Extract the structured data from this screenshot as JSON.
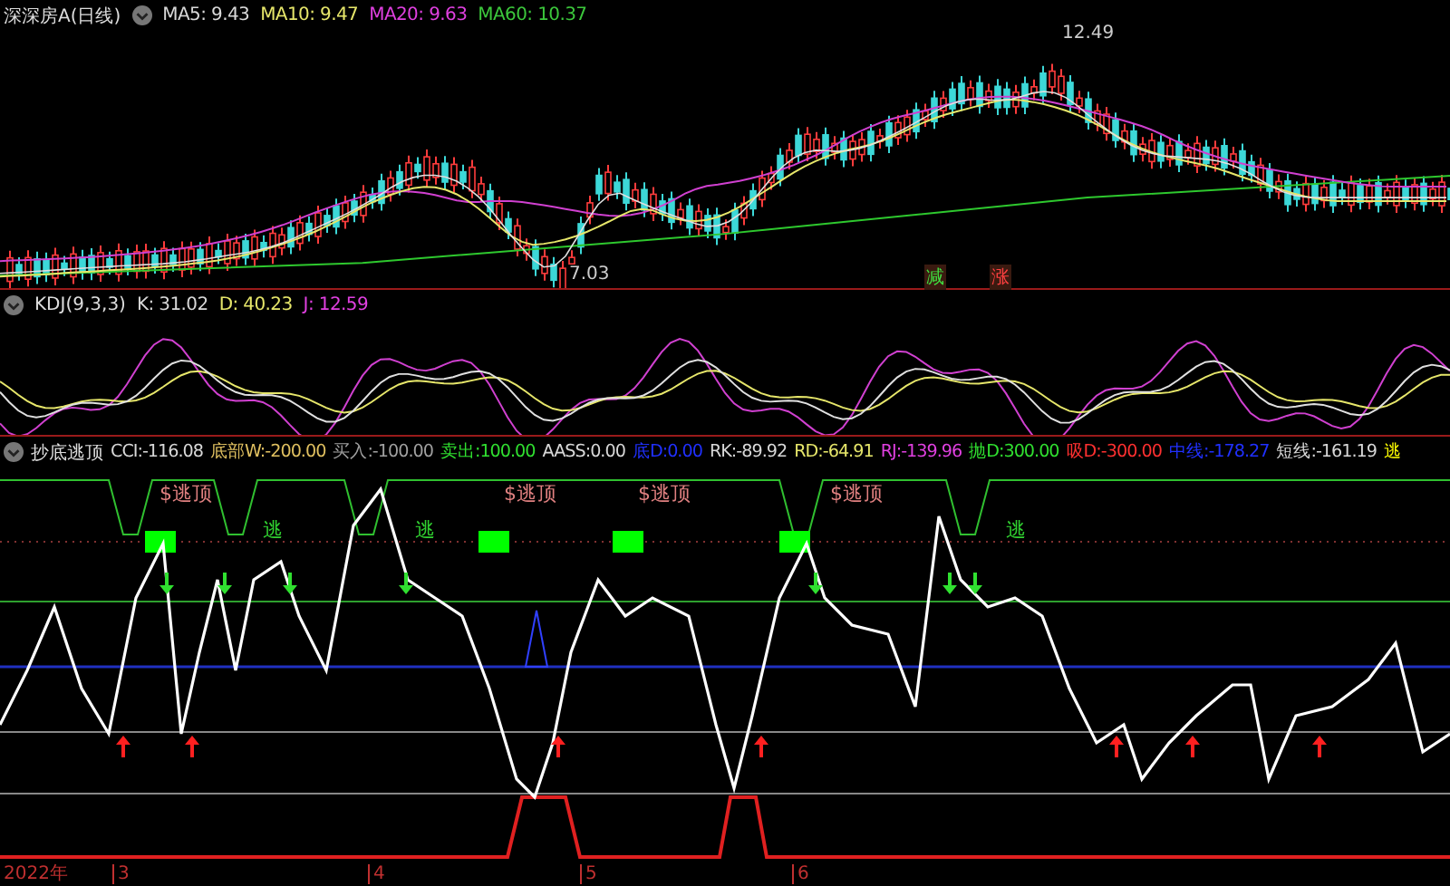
{
  "price_panel": {
    "title": "深深房A(日线)",
    "indicators": [
      {
        "label": "MA5:",
        "value": "9.43",
        "color": "#d8d8d8"
      },
      {
        "label": "MA10:",
        "value": "9.47",
        "color": "#e6e66a"
      },
      {
        "label": "MA20:",
        "value": "9.63",
        "color": "#e040e0"
      },
      {
        "label": "MA60:",
        "value": "10.37",
        "color": "#3cc83c"
      }
    ],
    "high_label": "12.49",
    "low_label": "7.03",
    "markers": [
      {
        "text": "减"
      },
      {
        "text": "涨"
      }
    ]
  },
  "kdj_panel": {
    "title": "KDJ(9,3,3)",
    "indicators": [
      {
        "label": "K:",
        "value": "31.02",
        "color": "#d8d8d8"
      },
      {
        "label": "D:",
        "value": "40.23",
        "color": "#e6e66a"
      },
      {
        "label": "J:",
        "value": "12.59",
        "color": "#e040e0"
      }
    ]
  },
  "signal_panel": {
    "title": "抄底逃顶",
    "indicators": [
      {
        "label": "CCI:",
        "value": "-116.08",
        "color": "#d8d8d8"
      },
      {
        "label": "底部W:",
        "value": "-200.00",
        "color": "#e0c060"
      },
      {
        "label": "买入:",
        "value": "-100.00",
        "color": "#a0a0a0"
      },
      {
        "label": "卖出:",
        "value": "100.00",
        "color": "#30e030"
      },
      {
        "label": "AASS:",
        "value": "0.00",
        "color": "#d8d8d8"
      },
      {
        "label": "底D:",
        "value": "0.00",
        "color": "#2030ff"
      },
      {
        "label": "RK:",
        "value": "-89.92",
        "color": "#d8d8d8"
      },
      {
        "label": "RD:",
        "value": "-64.91",
        "color": "#e6e66a"
      },
      {
        "label": "RJ:",
        "value": "-139.96",
        "color": "#e040e0"
      },
      {
        "label": "抛D:",
        "value": "300.00",
        "color": "#30e030"
      },
      {
        "label": "吸D:",
        "value": "-300.00",
        "color": "#ff3030"
      },
      {
        "label": "中线:",
        "value": "-178.27",
        "color": "#2030ff"
      },
      {
        "label": "短线:",
        "value": "-161.19",
        "color": "#d8d8d8"
      },
      {
        "label": "逃",
        "color": "#ffff00"
      }
    ],
    "signals": [
      {
        "text": "$逃顶"
      },
      {
        "text": "逃"
      },
      {
        "text": "逃"
      },
      {
        "text": "$逃顶"
      },
      {
        "text": "$逃顶"
      },
      {
        "text": "$逃顶"
      },
      {
        "text": "逃"
      }
    ]
  },
  "time_axis": {
    "labels": [
      "2022年",
      "3",
      "4",
      "5",
      "6"
    ]
  }
}
